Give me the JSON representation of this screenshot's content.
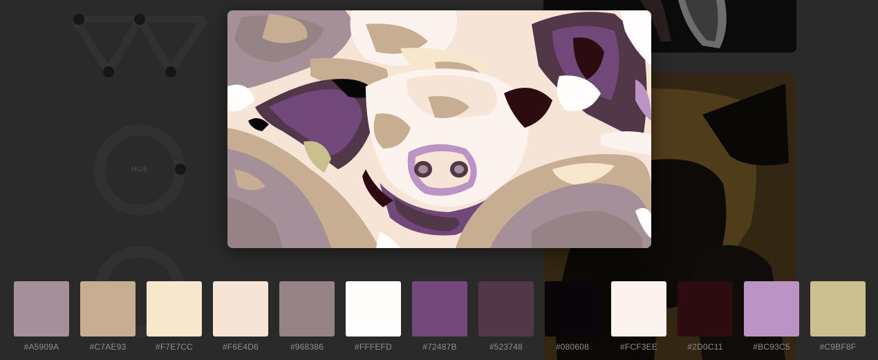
{
  "background": {
    "hue_label": "HUE"
  },
  "palette": [
    {
      "hex": "#A5909A",
      "label": "#A5909A"
    },
    {
      "hex": "#C7AE93",
      "label": "#C7AE93"
    },
    {
      "hex": "#F7E7CC",
      "label": "#F7E7CC"
    },
    {
      "hex": "#F6E4D6",
      "label": "#F6E4D6"
    },
    {
      "hex": "#968386",
      "label": "#968386"
    },
    {
      "hex": "#FFFEFD",
      "label": "#FFFEFD"
    },
    {
      "hex": "#72487B",
      "label": "#72487B"
    },
    {
      "hex": "#523748",
      "label": "#523748"
    },
    {
      "hex": "#080608",
      "label": "#080608"
    },
    {
      "hex": "#FCF3EE",
      "label": "#FCF3EE"
    },
    {
      "hex": "#2D0C11",
      "label": "#2D0C11"
    },
    {
      "hex": "#BC93C5",
      "label": "#BC93C5"
    },
    {
      "hex": "#C9BF8F",
      "label": "#C9BF8F"
    }
  ]
}
